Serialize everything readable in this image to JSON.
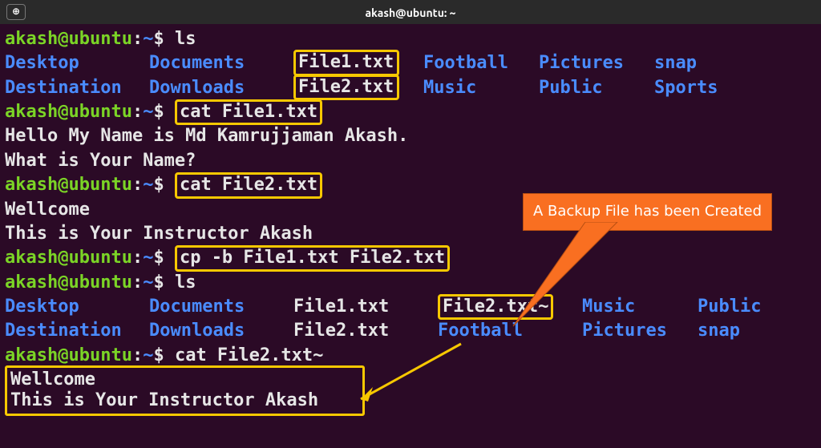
{
  "titlebar": {
    "newtab_glyph": "⊕",
    "title": "akash@ubuntu: ~"
  },
  "prompt": {
    "user_host": "akash@ubuntu",
    "path": "~",
    "sep": ":",
    "dollar": "$"
  },
  "commands": {
    "ls1": "ls",
    "cat1": "cat File1.txt",
    "cat2": "cat File2.txt",
    "cp": "cp -b File1.txt File2.txt",
    "ls2": "ls",
    "cat3": "cat File2.txt~"
  },
  "ls1": {
    "row1": {
      "c1": "Desktop",
      "c2": "Documents",
      "c3": "File1.txt",
      "c4": "Football",
      "c5": "Pictures",
      "c6": "snap"
    },
    "row2": {
      "c1": "Destination",
      "c2": "Downloads",
      "c3": "File2.txt",
      "c4": "Music",
      "c5": "Public",
      "c6": "Sports"
    }
  },
  "output": {
    "file1_l1": "Hello My Name is Md Kamrujjaman Akash.",
    "file1_l2": "What is Your Name?",
    "file2_l1": "Wellcome",
    "file2_l2": "This is Your Instructor Akash",
    "backup_l1": "Wellcome",
    "backup_l2": "This is Your Instructor Akash"
  },
  "ls2": {
    "row1": {
      "c1": "Desktop",
      "c2": "Documents",
      "c3": "File1.txt",
      "c4": "File2.txt~",
      "c5": "Music",
      "c6": "Public"
    },
    "row2": {
      "c1": "Destination",
      "c2": "Downloads",
      "c3": "File2.txt",
      "c4": "Football",
      "c5": "Pictures",
      "c6": "snap"
    }
  },
  "callout": {
    "text": "A Backup File has been Created"
  },
  "colors": {
    "bg": "#2b0a26",
    "fg": "#e6e6e6",
    "green": "#7bd426",
    "blue": "#4a8cff",
    "yellow_box": "#f7c800",
    "callout_bg": "#f96f21"
  }
}
